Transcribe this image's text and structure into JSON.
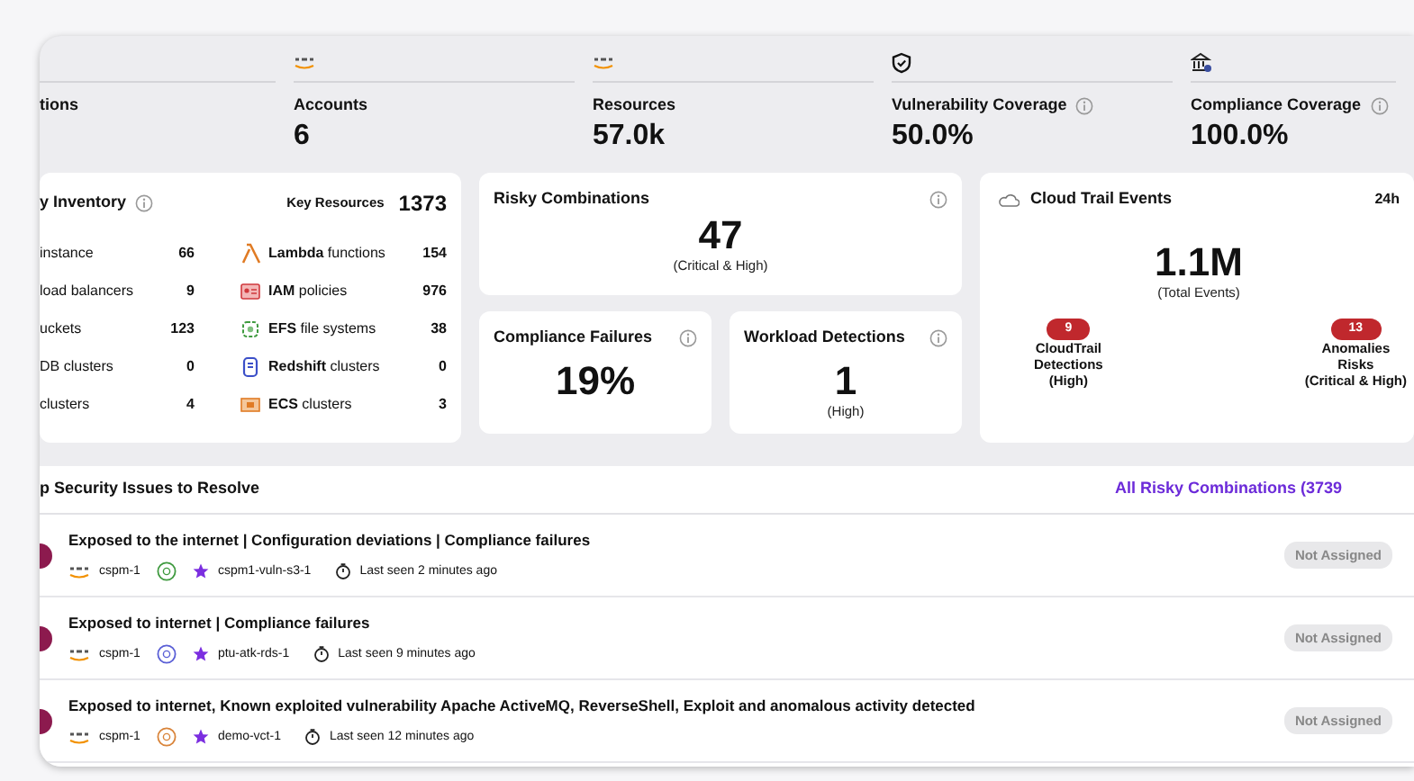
{
  "stats": [
    {
      "label": "tions",
      "info": false
    },
    {
      "label": "Accounts",
      "value": "6",
      "info": false
    },
    {
      "label": "Resources",
      "value": "57.0k",
      "info": false
    },
    {
      "label": "Vulnerability Coverage",
      "value": "50.0%",
      "info": true
    },
    {
      "label": "Compliance Coverage",
      "value": "100.0%",
      "info": true
    }
  ],
  "inventory": {
    "title": "y Inventory",
    "key_label": "Key Resources",
    "key_value": "1373",
    "left": [
      {
        "name": "instance",
        "count": "66"
      },
      {
        "name": "load balancers",
        "count": "9"
      },
      {
        "name": "uckets",
        "count": "123"
      },
      {
        "name": "DB clusters",
        "count": "0"
      },
      {
        "name": "clusters",
        "count": "4"
      }
    ],
    "right": [
      {
        "name": "**Lambda** functions",
        "count": "154"
      },
      {
        "name": "**IAM** policies",
        "count": "976"
      },
      {
        "name": "**EFS** file systems",
        "count": "38"
      },
      {
        "name": "**Redshift** clusters",
        "count": "0"
      },
      {
        "name": "**ECS** clusters",
        "count": "3"
      }
    ]
  },
  "risky": {
    "title": "Risky Combinations",
    "value": "47",
    "note": "(Critical & High)"
  },
  "compliance": {
    "title": "Compliance Failures",
    "value": "19%"
  },
  "workload": {
    "title": "Workload Detections",
    "value": "1",
    "note": "(High)"
  },
  "cloudtrail": {
    "title": "Cloud Trail Events",
    "period": "24h",
    "value": "1.1M",
    "note": "(Total Events)",
    "badges": [
      {
        "count": "9",
        "lines": [
          "CloudTrail",
          "Detections",
          "(High)"
        ]
      },
      {
        "count": "13",
        "lines": [
          "Anomalies",
          "Risks",
          "(Critical & High)"
        ]
      }
    ]
  },
  "issues": {
    "title": "p Security Issues to Resolve",
    "link": "All Risky Combinations (3739",
    "rows": [
      {
        "title": "Exposed to the internet | Configuration deviations | Compliance failures",
        "account": "cspm-1",
        "color": "#3f9a3f",
        "resource": "cspm1-vuln-s3-1",
        "seen": "Last seen 2 minutes ago",
        "status": "Not Assigned"
      },
      {
        "title": "Exposed to internet | Compliance failures",
        "account": "cspm-1",
        "color": "#5a5fd6",
        "resource": "ptu-atk-rds-1",
        "seen": "Last seen 9 minutes ago",
        "status": "Not Assigned"
      },
      {
        "title": "Exposed to internet, Known exploited vulnerability Apache ActiveMQ, ReverseShell, Exploit and anomalous activity detected",
        "account": "cspm-1",
        "color": "#d9843a",
        "resource": "demo-vct-1",
        "seen": "Last seen 12 minutes ago",
        "status": "Not Assigned"
      }
    ]
  }
}
